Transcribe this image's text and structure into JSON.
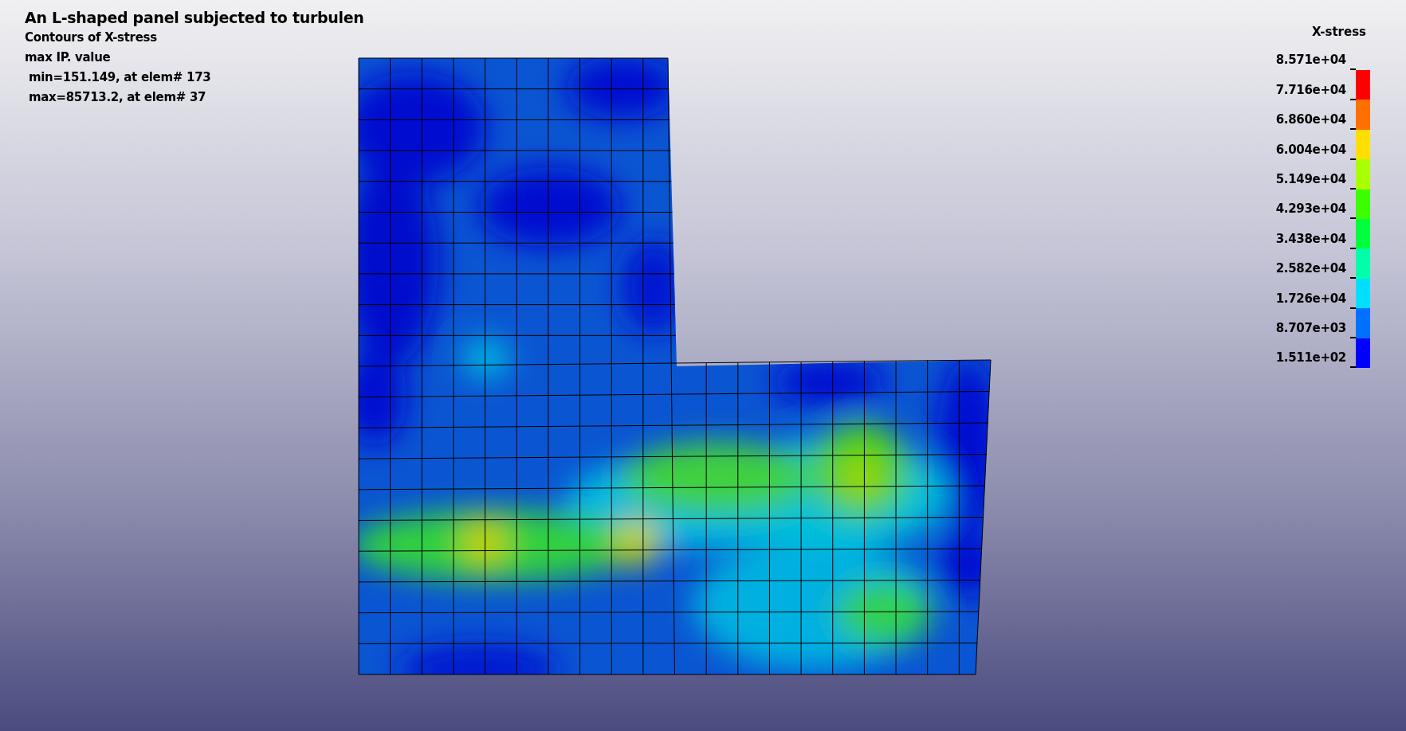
{
  "info": {
    "title": "An L-shaped panel subjected to turbulen",
    "lines": [
      "Contours of X-stress",
      "max IP. value",
      " min=151.149, at elem# 173",
      " max=85713.2, at elem# 37"
    ]
  },
  "legend": {
    "title": "X-stress",
    "labels": [
      "8.571e+04",
      "7.716e+04",
      "6.860e+04",
      "6.004e+04",
      "5.149e+04",
      "4.293e+04",
      "3.438e+04",
      "2.582e+04",
      "1.726e+04",
      "8.707e+03",
      "1.511e+02"
    ],
    "bands": [
      {
        "color": "#ff0000"
      },
      {
        "color": "#ff7000"
      },
      {
        "color": "#ffdf00"
      },
      {
        "color": "#aaff00"
      },
      {
        "color": "#3cff00"
      },
      {
        "color": "#00ff3c"
      },
      {
        "color": "#00ffaa"
      },
      {
        "color": "#00dfff"
      },
      {
        "color": "#0070ff"
      },
      {
        "color": "#0000ff"
      }
    ]
  }
}
